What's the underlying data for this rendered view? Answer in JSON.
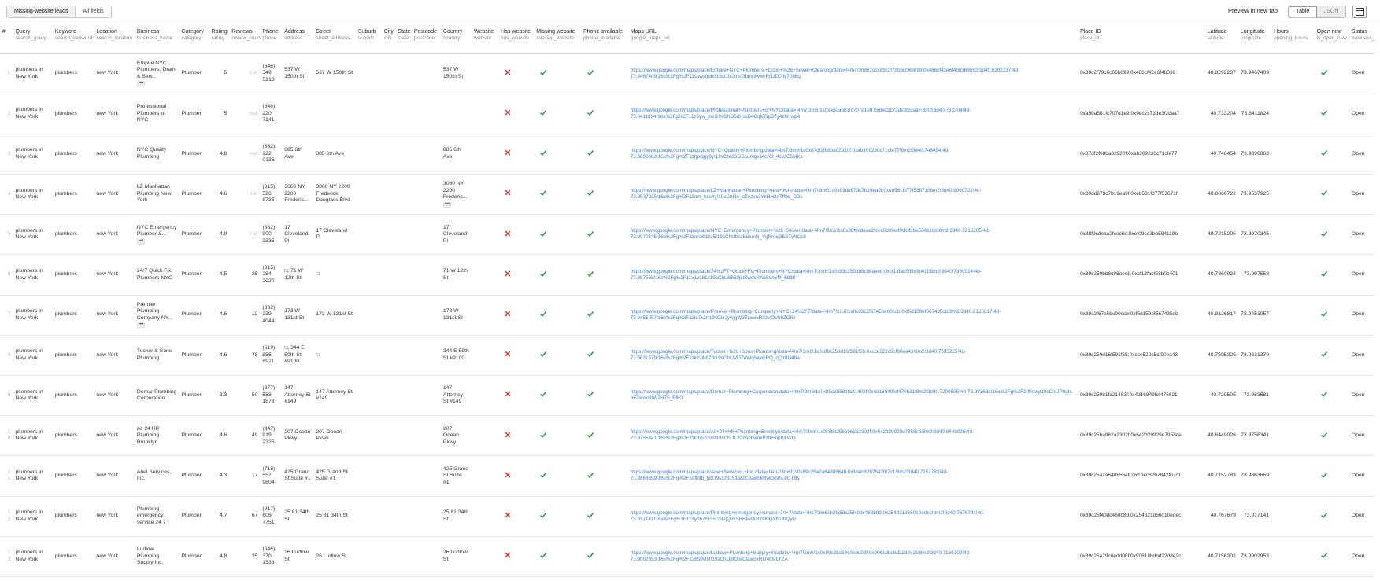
{
  "toolbar": {
    "filter_tabs": [
      "Missing-website leads",
      "All fields"
    ],
    "preview_label": "Preview in new tab",
    "view_tabs": [
      "Table",
      "JSON"
    ]
  },
  "columns": [
    {
      "label": "#",
      "key": ""
    },
    {
      "label": "Query",
      "key": "search_query"
    },
    {
      "label": "Keyword",
      "key": "search_keyword"
    },
    {
      "label": "Location",
      "key": "search_location"
    },
    {
      "label": "Business",
      "key": "business_name"
    },
    {
      "label": "Category",
      "key": "category"
    },
    {
      "label": "Rating",
      "key": "rating"
    },
    {
      "label": "Reviews",
      "key": "review_count"
    },
    {
      "label": "Phone",
      "key": "phone"
    },
    {
      "label": "Address",
      "key": "address"
    },
    {
      "label": "Street",
      "key": "street_address"
    },
    {
      "label": "Suburb",
      "key": "suburb"
    },
    {
      "label": "City",
      "key": "city"
    },
    {
      "label": "State",
      "key": "state"
    },
    {
      "label": "Postcode",
      "key": "postcode"
    },
    {
      "label": "Country",
      "key": "country"
    },
    {
      "label": "Website",
      "key": "website"
    },
    {
      "label": "Has website",
      "key": "has_website"
    },
    {
      "label": "Missing website",
      "key": "missing_website"
    },
    {
      "label": "Phone available",
      "key": "phone_available"
    },
    {
      "label": "Maps URL",
      "key": "google_maps_url"
    },
    {
      "label": "Place ID",
      "key": "place_id"
    },
    {
      "label": "Latitude",
      "key": "latitude"
    },
    {
      "label": "Longitude",
      "key": "longitude"
    },
    {
      "label": "Hours",
      "key": "opening_hours"
    },
    {
      "label": "Open now",
      "key": "is_open_now"
    },
    {
      "label": "Status",
      "key": "business_"
    }
  ],
  "rows": [
    {
      "idx": "1",
      "query": "plumbers in New York",
      "keyword": "plumbers",
      "location": "new York",
      "business": "Empire NYC Plumbers, Drain & Sew...",
      "business_more": true,
      "category": "Plumber",
      "rating": "5",
      "reviews": "null",
      "phone": "(646) 349 6213",
      "address": "537 W 150th St",
      "address_more": false,
      "street": "537 W 150th St",
      "country": "537 W 150th St",
      "country_more": false,
      "url": "https://www.google.com/maps/place/Empire+NYC+Plumbers,+Drain+%26+Sewer+Cleaning/data=!4m7!3m6!1s0x89c2f79b6c06b899:0x486cf42e6f4b036!8m2!3d40.8292237!4d-73.9467409!16s%2Fg%2F11sswshbbt!19sChIJmbGbbv3wwkRNzD0by70b6g",
      "place_id": "0x89c2f79b6c06b899:0x486cf42e6f4b036",
      "lat": "40.8292237",
      "lng": "73.9467409",
      "status": "Open"
    },
    {
      "idx": "2",
      "query": "plumbers in New York",
      "keyword": "plumbers",
      "location": "new York",
      "business": "Professional Plumbers of NYC",
      "business_more": false,
      "category": "Plumber",
      "rating": "5",
      "reviews": "null",
      "phone": "(646) 220 7141",
      "address": "",
      "address_more": false,
      "street": "",
      "country": "",
      "country_more": false,
      "url": "https://www.google.com/maps/place/Professional+Plumbers+of+NYC/data=!4m7!3m6!1s0xa50a581fc707d1e9:0x9ec2c73de3f2caa7!8m2!3d40.733204!4d-73.8411824!16s%2Fg%2F11z5yw_pw!19sChIJ6dHxxB4CqMRpB7y4z8Hwp4",
      "place_id": "0xa50a581fc707d1e9:0x9ec2c73de3f2caa7",
      "lat": "40.733204",
      "lng": "73.8411824",
      "status": "Open"
    },
    {
      "idx": "3",
      "query": "plumbers in New York",
      "keyword": "plumbers",
      "location": "new York",
      "business": "NYC Quality Plumbing",
      "business_more": false,
      "category": "Plumber",
      "rating": "4.8",
      "reviews": "null",
      "phone": "(332) 222 0135",
      "address": "885 6th Ave",
      "address_more": false,
      "street": "885 6th Ave",
      "country": "885 6th Ave",
      "country_more": false,
      "url": "https://www.google.com/maps/place/NYC+Quality+Plumbing/data=!4m7!3m6!1s0x87df2f68ba02920f:0xab309230c71cfe77!8m2!3d40.748454!4d-73.9890863!16s%2Fg%2F11fgxqgy9y!19sChIJD5IScumgv34cRd_4cvzC5MKs",
      "place_id": "0x87df2f68ba02920f:0xab309230c71cfe77",
      "lat": "40.748454",
      "lng": "73.9890863",
      "status": "Open"
    },
    {
      "idx": "4",
      "query": "plumbers in New York",
      "keyword": "plumbers",
      "location": "new York",
      "business": "LZ Manhattan Plumbing New York",
      "business_more": false,
      "category": "Plumber",
      "rating": "4.6",
      "reviews": "null",
      "phone": "(315) 526 8735",
      "address": "3060 NY 2200 Frederic...",
      "address_more": false,
      "street": "3060 NY 2200 Frederick Douglass Blvd",
      "country": "3060 NY 2200 Frederic...",
      "country_more": true,
      "url": "https://www.google.com/maps/place/LZ+Manhattan+Plumbing+New+York/data=!4m7!3m6!1s0x89dd673c7b19ea9f:0xeb581fd77f53671f!8m2!3d40.8060722!4d-73.9537925!16s%2Fg%2F11nm_hss4y!19sChIJn_oZezxn3YkRH2oTff9c_DDs",
      "place_id": "0x89dd673c7b19ea9f:0xeb581fd77f53671f",
      "lat": "40.8060722",
      "lng": "73.9537925",
      "status": "Open"
    },
    {
      "idx": "5",
      "query": "plumbers in New York",
      "keyword": "plumbers",
      "location": "new York",
      "business": "NYC Emergency Plumber &...",
      "business_more": true,
      "category": "Plumber",
      "rating": "4.9",
      "reviews": "null",
      "phone": "(332) 900 3335",
      "address": "17 Cleveland Pl",
      "address_more": false,
      "street": "17 Cleveland Pl",
      "country": "17 Cleveland Pl",
      "country_more": false,
      "url": "https://www.google.com/maps/place/NYC+Emergency+Plumber+%26+Sewer/data=!4m7!3m6!1s0x88f9cdeaa2fcec6d:0xef09cd3be584119b!8m2!3d40.7215205!4d-73.9970345!16s%2Fg%2F11nn3b1zz5!19sChIJbczBoiuriN_YgRmxGE5TvNCc8",
      "place_id": "0x88f9cdeaa2fcec6d:0xef09cd3be584119b",
      "lat": "40.7215205",
      "lng": "73.9970345",
      "status": "Open"
    },
    {
      "idx": "6",
      "query": "plumbers in New York",
      "keyword": "plumbers",
      "location": "new York",
      "business": "24/7 Quick Fix Plumbers NYC",
      "business_more": false,
      "category": "Plumber",
      "rating": "4.5",
      "reviews": "25",
      "phone": "(315) 284 2020",
      "address": "□, 71 W 12th St",
      "address_more": false,
      "street": "□",
      "country": "71 W 12th St",
      "country_more": false,
      "url": "https://www.google.com/maps/place/24%2F7+Quick+Fix+Plumbers+NYC/data=!4m7!3m6!1s0x89c259bb8c98aeeb:0xcf13facf58b0b401!8m2!3d40.7360924!4d-73.997558!16s%2Fg%2F11v1v181l!19sChIJ6669jLtZwokRAbSwWM_6898",
      "place_id": "0x89c259bb8c98aeeb:0xcf13facf58b0b401",
      "lat": "40.7360924",
      "lng": "73.997558",
      "status": "Open"
    },
    {
      "idx": "7",
      "query": "plumbers in New York",
      "keyword": "plumbers",
      "location": "new York",
      "business": "Premier Plumbing Company NY...",
      "business_more": true,
      "category": "Plumber",
      "rating": "4.6",
      "reviews": "12",
      "phone": "(332) 239 4044",
      "address": "173 W 131st St",
      "address_more": false,
      "street": "173 W 131st St",
      "country": "173 W 131st St",
      "country_more": false,
      "url": "https://www.google.com/maps/place/Premier+Plumbing+Company+NYC+24%2F7/data=!4m7!3m6!1s0x89c2f67e5be00ccb:0xf5d159ef567435db!8m2!3d40.8126817!4d-73.9451057!16s%2Fg%2F11tc7k2r!19sChIJywjgW37zwokR2zVOVu9ZOfU",
      "place_id": "0x89c2f67e5be00ccb:0xf5d159ef567435db",
      "lat": "40.8126817",
      "lng": "73.9451057",
      "status": "Open"
    },
    {
      "idx": "8",
      "query": "plumbers in New York",
      "keyword": "plumbers",
      "location": "new York",
      "business": "Tucker & Sons Plumbing",
      "business_more": false,
      "category": "Plumber",
      "rating": "4.6",
      "reviews": "78",
      "phone": "(619) 855 8911",
      "address": "□, 344 E 59th St #9100",
      "address_more": false,
      "street": "□",
      "country": "344 E 59th St #9100",
      "country_more": false,
      "url": "https://www.google.com/maps/place/Tucker+%26+Sons+Plumbing/data=!4m7!3m6!1s0x89c259d16f591f55:0xcce522c5cf90ea43!8m2!3d40.7595225!4d-73.9631379!16s%2Fg%2F11kz7l8b78!19sChIJVfJZ0Wq5wokRQ_qQz8U48w",
      "place_id": "0x89c259d16f591f55:0xcce522c5cf90ea43",
      "lat": "40.7595225",
      "lng": "73.9631379",
      "status": "Open"
    },
    {
      "idx": "9",
      "query": "plumbers in New York",
      "keyword": "plumbers",
      "location": "new York",
      "business": "Demar Plumbing Corporation",
      "business_more": false,
      "category": "Plumber",
      "rating": "3.3",
      "reviews": "50",
      "phone": "(877) 583 1878",
      "address": "147 Attorney St #149",
      "address_more": false,
      "street": "147 Attorney St #149",
      "country": "147 Attorney St #149",
      "country_more": false,
      "url": "https://www.google.com/maps/place/Demar+Plumbing+Corporation/data=!4m7!3m6!1s0x89c25981fa21483f:0x4d16849fef476621!8m2!3d40.7200505!4d-73.983681!16s%2Fg%2F1tf0ovg!19sChIJP0gIs-oFZwokRIWZH75_Efk0",
      "place_id": "0x89c25981fa21483f:0x4d16849fef476621",
      "lat": "40.720505",
      "lng": "73.983681",
      "status": "Open"
    },
    {
      "idx": "10",
      "query": "plumbers in New York",
      "keyword": "plumbers",
      "location": "new York",
      "business": "All 24 HR Plumbing Brooklyn",
      "business_more": false,
      "category": "Plumber",
      "rating": "4.6",
      "reviews": "49",
      "phone": "(347) 919 2325",
      "address": "207 Ocean Pkwy",
      "address_more": false,
      "street": "207 Ocean Pkwy",
      "country": "207 Ocean Pkwy",
      "country_more": false,
      "url": "https://www.google.com/maps/place/All+24+HR+Plumbing+Brooklyn/data=!4m7!3m6!1s0x89c25ba962a2302f:0x642d29929e7958ce!8m2!3d40.6449026!4d-73.9756341!16s%2Fg%2F11kthp7mm!19sChIJLzCiYqlbwokRzlh5npIpLWQ",
      "place_id": "0x89c25ba962a2302f:0x642d29929e7958ce",
      "lat": "40.6449026",
      "lng": "73.9756341",
      "status": "Open"
    },
    {
      "idx": "11",
      "query": "plumbers in New York",
      "keyword": "plumbers",
      "location": "new York",
      "business": "Ariel Services, Inc.",
      "business_more": false,
      "category": "Plumber",
      "rating": "4.3",
      "reviews": "17",
      "phone": "(718) 557 9604",
      "address": "425 Grand St Suite #1",
      "address_more": false,
      "street": "425 Grand St Suite #1",
      "country": "425 Grand St Suite #1",
      "country_more": false,
      "url": "https://www.google.com/maps/place/Ariel+Services,+Inc./data=!4m7!3m6!1s0x89c25a2a6488564b:0x1b4c82b7842f07c1!8m2!3d40.7152783!4d-73.9863659!16s%2Fg%2F1dfk9b_hd!19sChIJS1aIZCpawokRwQcvhLeCTBs",
      "place_id": "0x89c25a2a6488564b:0x1b4c82b7842f07c1",
      "lat": "40.7152783",
      "lng": "73.9863659",
      "status": "Open"
    },
    {
      "idx": "12",
      "query": "plumbers in New York",
      "keyword": "plumbers",
      "location": "new York",
      "business": "Plumbing emergency service 24 7",
      "business_more": false,
      "category": "Plumber",
      "rating": "4.7",
      "reviews": "67",
      "phone": "(917) 608 7751",
      "address": "25 81 34th St",
      "address_more": false,
      "street": "25 81 34th St",
      "country": "25 81 34th St",
      "country_more": false,
      "url": "https://www.google.com/maps/place/Plumbing+emergency+service+24+7/data=!4m7!3m6!1s0x89c25f40dc460b8d:0x254321d56010edec!8m2!3d40.7676791!4d-73.917141!16s%2Fg%2F11dybb7l!19sChIJjQtGSBBfwokR7O0QYNUhQyU",
      "place_id": "0x89c25f40dc460b8d:0x254321d56010edec",
      "lat": "40.767679",
      "lng": "73.917141",
      "status": "Open"
    },
    {
      "idx": "13",
      "query": "plumbers in New York",
      "keyword": "plumbers",
      "location": "new York",
      "business": "Ludlow Plumbing Supply Inc.",
      "business_more": false,
      "category": "Plumber",
      "rating": "4.8",
      "reviews": "25",
      "phone": "(646) 370 1338",
      "address": "26 Ludlow St",
      "address_more": false,
      "street": "26 Ludlow St",
      "country": "26 Ludlow St",
      "country_more": false,
      "url": "https://www.google.com/maps/place/Ludlow+Plumbing+Supply+Inc/data=!4m7!3m6!1s0x89c25a29c0edd08f:0x90618bdbd22d8e2c!8m2!3d40.7156302!4d-73.9902953!16s%2Fg%2F12659vfsf!19sChIJj9DtwClawokRLI4t0vLYZA",
      "place_id": "0x89c25a29c0edd08f:0x90618bdbd22d8e2c",
      "lat": "40.7156302",
      "lng": "73.9902953",
      "status": "Open"
    }
  ],
  "colors": {
    "check": "#1a9c3e",
    "cross": "#d9342b",
    "link": "#3a7bd5"
  },
  "icons": {
    "has_website": "x-icon",
    "missing_website": "check-icon",
    "phone_available": "check-icon",
    "open_now": "check-icon",
    "layout_toggle": "panel-layout-icon"
  }
}
